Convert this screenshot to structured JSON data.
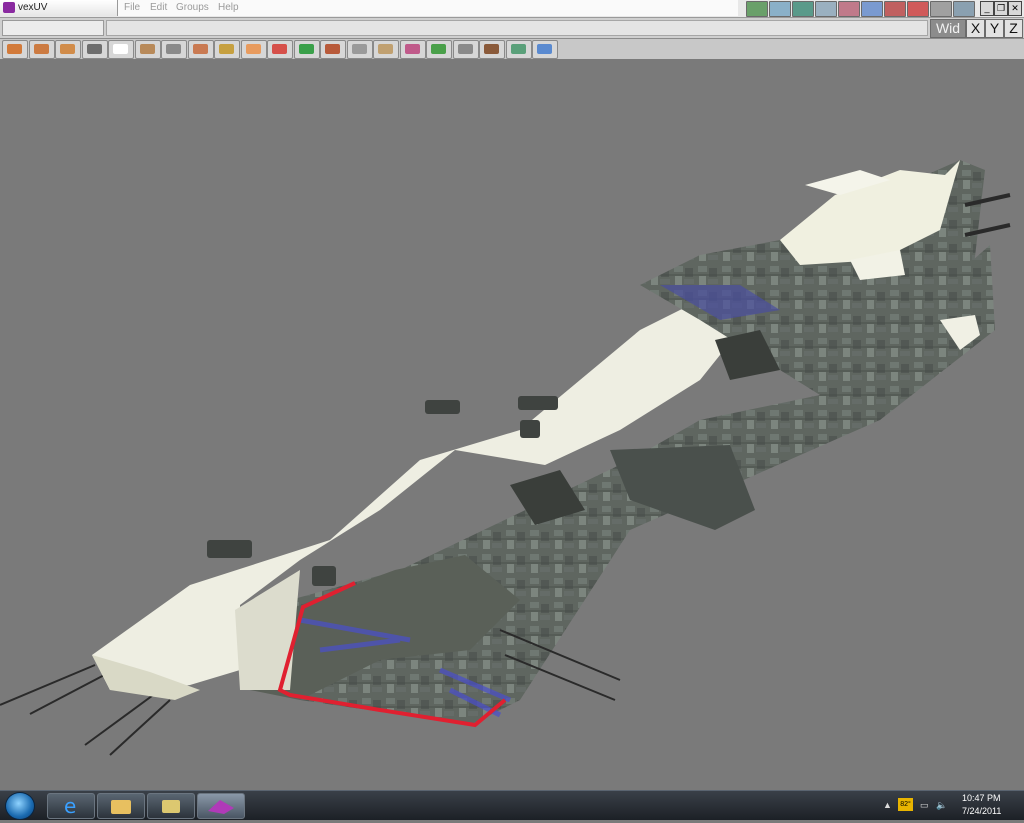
{
  "window": {
    "title": "vexUV"
  },
  "menu": {
    "items": [
      "File",
      "Edit",
      "Groups",
      "Help"
    ]
  },
  "axis_buttons": {
    "wid": "Wid",
    "x": "X",
    "y": "Y",
    "z": "Z"
  },
  "window_controls": {
    "minimize": "_",
    "restore": "❐",
    "close": "✕"
  },
  "toolbar": {
    "icon_colors": [
      "#d27a3a",
      "#cc7b42",
      "#d18c4a",
      "#6e6e6e",
      "#ffffff",
      "#b88a5a",
      "#8a8a8a",
      "#c97a52",
      "#c6a040",
      "#e89b5e",
      "#d6504a",
      "#3aa04a",
      "#b85a3a",
      "#9a9a9a",
      "#c0a070",
      "#c05a8a",
      "#4aa04a",
      "#8a8a8a",
      "#8a5a3a",
      "#5aa07a",
      "#5a8ad0"
    ],
    "icons": [
      "box-select-icon",
      "box-edge-icon",
      "cube-icon",
      "camera-icon",
      "pointer-icon",
      "move-icon",
      "arrow-down-icon",
      "face-icon",
      "fill-icon",
      "sphere-icon",
      "material-icon",
      "weld-icon",
      "paint-icon",
      "lasso-icon",
      "ruler-icon",
      "pencil-icon",
      "uv-box-icon",
      "axis-icon",
      "scale-icon",
      "render-icon",
      "3d-view-icon"
    ]
  },
  "top_icons": {
    "colors": [
      "#6aa06a",
      "#8ab0c8",
      "#5a9a8a",
      "#9ab0c0",
      "#c07a8a",
      "#7a9ad0",
      "#c06060",
      "#d05a5a",
      "#a0a0a0",
      "#8aa0b0",
      "#d09030"
    ]
  },
  "viewport": {
    "background": "#7a7a7a",
    "selection_color": "#e02030"
  },
  "taskbar": {
    "tray": {
      "temperature": "82°",
      "time": "10:47 PM",
      "date": "7/24/2011"
    },
    "pinned": [
      "internet-explorer-icon",
      "file-explorer-icon",
      "folders-icon",
      "vexuv-app-icon"
    ]
  }
}
